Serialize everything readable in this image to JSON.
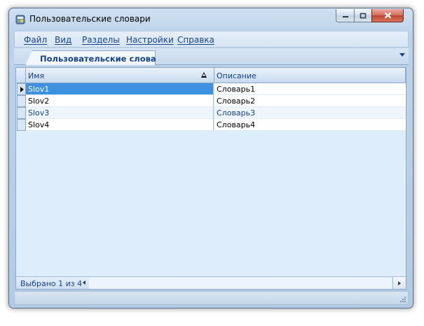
{
  "window": {
    "title": "Пользовательские словари"
  },
  "menu": [
    {
      "label": "Файл"
    },
    {
      "label": "Вид"
    },
    {
      "label": "Разделы"
    },
    {
      "label": "Настройки"
    },
    {
      "label": "Справка"
    }
  ],
  "tab": {
    "label": "Пользовательские словари"
  },
  "grid": {
    "columns": [
      {
        "label": "Имя",
        "sort": "ascending"
      },
      {
        "label": "Описание"
      }
    ],
    "rows": [
      {
        "name": "Slov1",
        "desc": "Словарь1",
        "selected": true
      },
      {
        "name": "Slov2",
        "desc": "Словарь2"
      },
      {
        "name": "Slov3",
        "desc": "Словарь3"
      },
      {
        "name": "Slov4",
        "desc": "Словарь4"
      }
    ],
    "status": "Выбрано 1 из 4"
  },
  "colors": {
    "accent": "#15428b",
    "selection": "#3d91df",
    "frame": "#b2cbe4"
  }
}
